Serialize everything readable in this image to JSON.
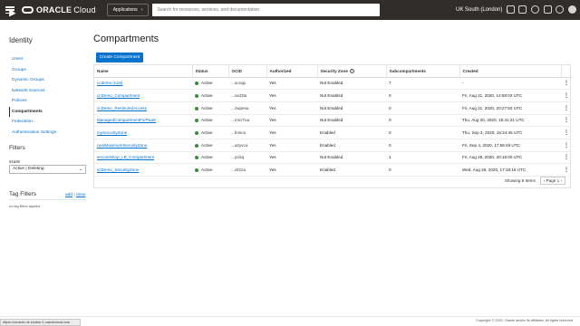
{
  "topbar": {
    "logo_bold": "ORACLE",
    "logo_text": "Cloud",
    "apps_label": "Applications",
    "search_placeholder": "Search for resources, services, and documentation",
    "region": "UK South (London)"
  },
  "sidebar": {
    "title": "Identity",
    "items": [
      {
        "label": "Users"
      },
      {
        "label": "Groups"
      },
      {
        "label": "Dynamic Groups"
      },
      {
        "label": "Network Sources"
      },
      {
        "label": "Policies"
      },
      {
        "label": "Compartments"
      },
      {
        "label": "Federation"
      },
      {
        "label": "Authentication Settings"
      }
    ],
    "active_index": 5,
    "filters_title": "Filters",
    "state_label": "STATE",
    "state_value": "Active | Deleting",
    "tag_filters_title": "Tag Filters",
    "tag_add": "add",
    "tag_clear": "clear",
    "no_tags": "no tag filters applied"
  },
  "main": {
    "title": "Compartments",
    "create_button": "Create Compartment",
    "columns": [
      "Name",
      "Status",
      "OCID",
      "Authorized",
      "Security Zone",
      "Subcompartments",
      "Created"
    ],
    "rows": [
      {
        "name": "ccdemo (root)",
        "status": "Active",
        "ocid": "...ucxqp",
        "authorized": "Yes",
        "zone": "Not Enabled",
        "sub": "7",
        "created": "-"
      },
      {
        "name": "ccDemo_Compartment",
        "status": "Active",
        "ocid": "...xxd3ta",
        "authorized": "Yes",
        "zone": "Not Enabled",
        "sub": "0",
        "created": "Fri, Aug 21, 2020, 14:58:02 UTC"
      },
      {
        "name": "ccDemo_RestrictedAccess",
        "status": "Active",
        "ocid": "...zwpesa",
        "authorized": "Yes",
        "zone": "Not Enabled",
        "sub": "0",
        "created": "Fri, Aug 21, 2020, 20:27:50 UTC"
      },
      {
        "name": "ManagedCompartmentForPaaS",
        "status": "Active",
        "ocid": "...mnz7ua",
        "authorized": "Yes",
        "zone": "Not Enabled",
        "sub": "0",
        "created": "Thu, Aug 20, 2020, 15:41:21 UTC"
      },
      {
        "name": "mySecurityZone",
        "status": "Active",
        "ocid": "...fmsca",
        "authorized": "Yes",
        "zone": "Enabled",
        "sub": "0",
        "created": "Thu, Sep 3, 2020, 15:24:45 UTC"
      },
      {
        "name": "newMaximumSecurityZone",
        "status": "Active",
        "ocid": "...a2yvca",
        "authorized": "Yes",
        "zone": "Enabled",
        "sub": "0",
        "created": "Fri, Sep 4, 2020, 17:59:49 UTC"
      },
      {
        "name": "secureShop_LB_Compartment",
        "status": "Active",
        "ocid": "...ycikq",
        "authorized": "Yes",
        "zone": "Not Enabled",
        "sub": "1",
        "created": "Fri, Aug 28, 2020, 20:16:00 UTC"
      },
      {
        "name": "szDemo_SecurityZone",
        "status": "Active",
        "ocid": "...ctl22a",
        "authorized": "Yes",
        "zone": "Enabled",
        "sub": "0",
        "created": "Wed, Aug 26, 2020, 17:18:16 UTC"
      }
    ],
    "showing": "Showing 8 Items",
    "page": "Page 1"
  },
  "statusbar_text": "https://console.uk-london-1.oraclecloud.com",
  "copyright": "Copyright © 2020, Oracle and/or its affiliates. All rights reserved.",
  "colors": {
    "topbar": "#312d2a",
    "link": "#0572ce",
    "active_dot": "#3a8a3a"
  }
}
